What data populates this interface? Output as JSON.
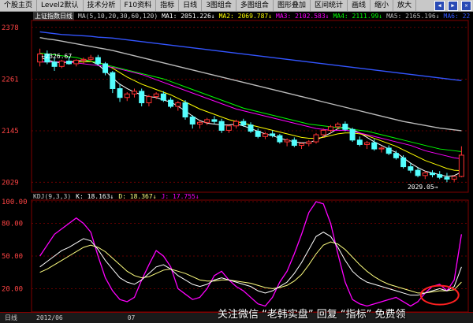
{
  "toolbar": {
    "items": [
      "个股主页",
      "Level2默认",
      "技术分析",
      "F10资料",
      "指标",
      "日线",
      "3图组合",
      "多图组合",
      "图形叠加",
      "区间统计",
      "画线",
      "缩小",
      "放大"
    ],
    "window_buttons": [
      "◀",
      "▶",
      "✕"
    ]
  },
  "main_header": {
    "title": "上证指数日线",
    "ma_params": "MA(5,10,20,30,60,120)",
    "ma1": "MA1: 2051.226↓",
    "ma2": "MA2: 2069.787↓",
    "ma3": "MA3: 2102.583↓",
    "ma4": "MA4: 2111.99↓",
    "ma5": "MA5: 2165.196↓",
    "ma6": "MA6: 22"
  },
  "kdj_header": {
    "name": "KDJ(9,3,3)",
    "k": "K: 18.163↓",
    "d": "D: 18.367↓",
    "j": "J: 17.755↓"
  },
  "price_axis": [
    "2378",
    "2261",
    "2145",
    "2029"
  ],
  "kdj_axis": [
    "100.00",
    "80.00",
    "50.00",
    "20.00"
  ],
  "annotations": {
    "high": "2326.67",
    "low": "2029.05"
  },
  "bottom_bar": {
    "period": "日线",
    "date1": "2012/06",
    "date2": "07"
  },
  "watermark": "关注微信 “老韩实盘” 回复 “指标” 免费领",
  "colors": {
    "up": "#ff3232",
    "down": "#54ffff",
    "ma1": "#ffffff",
    "ma2": "#ffff00",
    "ma3": "#ff00ff",
    "ma4": "#00ff00",
    "ma5": "#bbbbbb",
    "ma6": "#3355ff",
    "k_line": "#ffffff",
    "d_line": "#ffff80",
    "j_line": "#ff00ff",
    "grid": "#800000"
  },
  "chart_data": {
    "type": "candlestick",
    "y_range": [
      2010,
      2390
    ],
    "candles": [
      {
        "o": 2300,
        "h": 2330,
        "l": 2290,
        "c": 2318
      },
      {
        "o": 2318,
        "h": 2326,
        "l": 2295,
        "c": 2300
      },
      {
        "o": 2300,
        "h": 2310,
        "l": 2280,
        "c": 2290
      },
      {
        "o": 2290,
        "h": 2305,
        "l": 2286,
        "c": 2302
      },
      {
        "o": 2302,
        "h": 2312,
        "l": 2294,
        "c": 2296
      },
      {
        "o": 2296,
        "h": 2306,
        "l": 2290,
        "c": 2304
      },
      {
        "o": 2304,
        "h": 2310,
        "l": 2296,
        "c": 2306
      },
      {
        "o": 2306,
        "h": 2316,
        "l": 2300,
        "c": 2310
      },
      {
        "o": 2310,
        "h": 2316,
        "l": 2292,
        "c": 2296
      },
      {
        "o": 2296,
        "h": 2300,
        "l": 2270,
        "c": 2276
      },
      {
        "o": 2276,
        "h": 2280,
        "l": 2230,
        "c": 2240
      },
      {
        "o": 2240,
        "h": 2250,
        "l": 2210,
        "c": 2220
      },
      {
        "o": 2220,
        "h": 2232,
        "l": 2212,
        "c": 2228
      },
      {
        "o": 2228,
        "h": 2240,
        "l": 2220,
        "c": 2234
      },
      {
        "o": 2234,
        "h": 2240,
        "l": 2200,
        "c": 2208
      },
      {
        "o": 2208,
        "h": 2226,
        "l": 2200,
        "c": 2222
      },
      {
        "o": 2222,
        "h": 2232,
        "l": 2216,
        "c": 2228
      },
      {
        "o": 2228,
        "h": 2234,
        "l": 2210,
        "c": 2214
      },
      {
        "o": 2214,
        "h": 2220,
        "l": 2196,
        "c": 2200
      },
      {
        "o": 2200,
        "h": 2212,
        "l": 2190,
        "c": 2208
      },
      {
        "o": 2208,
        "h": 2214,
        "l": 2170,
        "c": 2176
      },
      {
        "o": 2176,
        "h": 2180,
        "l": 2150,
        "c": 2160
      },
      {
        "o": 2160,
        "h": 2168,
        "l": 2150,
        "c": 2164
      },
      {
        "o": 2164,
        "h": 2174,
        "l": 2158,
        "c": 2170
      },
      {
        "o": 2170,
        "h": 2178,
        "l": 2160,
        "c": 2166
      },
      {
        "o": 2166,
        "h": 2172,
        "l": 2140,
        "c": 2146
      },
      {
        "o": 2146,
        "h": 2158,
        "l": 2140,
        "c": 2156
      },
      {
        "o": 2156,
        "h": 2170,
        "l": 2150,
        "c": 2166
      },
      {
        "o": 2166,
        "h": 2172,
        "l": 2154,
        "c": 2158
      },
      {
        "o": 2158,
        "h": 2164,
        "l": 2140,
        "c": 2144
      },
      {
        "o": 2144,
        "h": 2150,
        "l": 2128,
        "c": 2132
      },
      {
        "o": 2132,
        "h": 2142,
        "l": 2126,
        "c": 2138
      },
      {
        "o": 2138,
        "h": 2146,
        "l": 2130,
        "c": 2134
      },
      {
        "o": 2134,
        "h": 2138,
        "l": 2116,
        "c": 2120
      },
      {
        "o": 2120,
        "h": 2128,
        "l": 2110,
        "c": 2124
      },
      {
        "o": 2124,
        "h": 2130,
        "l": 2108,
        "c": 2112
      },
      {
        "o": 2112,
        "h": 2118,
        "l": 2104,
        "c": 2116
      },
      {
        "o": 2116,
        "h": 2124,
        "l": 2110,
        "c": 2120
      },
      {
        "o": 2120,
        "h": 2140,
        "l": 2116,
        "c": 2136
      },
      {
        "o": 2136,
        "h": 2150,
        "l": 2130,
        "c": 2146
      },
      {
        "o": 2146,
        "h": 2158,
        "l": 2140,
        "c": 2154
      },
      {
        "o": 2154,
        "h": 2164,
        "l": 2148,
        "c": 2160
      },
      {
        "o": 2160,
        "h": 2166,
        "l": 2144,
        "c": 2148
      },
      {
        "o": 2148,
        "h": 2152,
        "l": 2120,
        "c": 2124
      },
      {
        "o": 2124,
        "h": 2132,
        "l": 2110,
        "c": 2114
      },
      {
        "o": 2114,
        "h": 2122,
        "l": 2104,
        "c": 2118
      },
      {
        "o": 2118,
        "h": 2126,
        "l": 2100,
        "c": 2104
      },
      {
        "o": 2104,
        "h": 2110,
        "l": 2096,
        "c": 2106
      },
      {
        "o": 2106,
        "h": 2112,
        "l": 2090,
        "c": 2094
      },
      {
        "o": 2094,
        "h": 2100,
        "l": 2080,
        "c": 2084
      },
      {
        "o": 2084,
        "h": 2090,
        "l": 2060,
        "c": 2064
      },
      {
        "o": 2064,
        "h": 2072,
        "l": 2050,
        "c": 2056
      },
      {
        "o": 2056,
        "h": 2062,
        "l": 2040,
        "c": 2044
      },
      {
        "o": 2044,
        "h": 2054,
        "l": 2036,
        "c": 2050
      },
      {
        "o": 2050,
        "h": 2056,
        "l": 2040,
        "c": 2046
      },
      {
        "o": 2046,
        "h": 2054,
        "l": 2036,
        "c": 2040
      },
      {
        "o": 2040,
        "h": 2050,
        "l": 2029,
        "c": 2036
      },
      {
        "o": 2036,
        "h": 2044,
        "l": 2030,
        "c": 2042
      },
      {
        "o": 2042,
        "h": 2110,
        "l": 2040,
        "c": 2090
      }
    ],
    "ma_series": [
      {
        "name": "MA1",
        "values": [
          2310,
          2305,
          2300,
          2298,
          2300,
          2302,
          2304,
          2302,
          2294,
          2280,
          2264,
          2250,
          2240,
          2232,
          2226,
          2222,
          2220,
          2214,
          2210,
          2200,
          2190,
          2178,
          2168,
          2162,
          2160,
          2158,
          2158,
          2160,
          2156,
          2150,
          2144,
          2138,
          2134,
          2128,
          2124,
          2120,
          2118,
          2118,
          2124,
          2132,
          2140,
          2150,
          2154,
          2148,
          2140,
          2130,
          2120,
          2112,
          2104,
          2096,
          2084,
          2072,
          2062,
          2054,
          2050,
          2046,
          2042,
          2044,
          2052
        ]
      },
      {
        "name": "MA2",
        "values": [
          2300,
          2300,
          2300,
          2300,
          2299,
          2300,
          2300,
          2301,
          2299,
          2294,
          2286,
          2276,
          2266,
          2258,
          2250,
          2244,
          2238,
          2232,
          2226,
          2218,
          2210,
          2202,
          2194,
          2188,
          2182,
          2176,
          2170,
          2166,
          2162,
          2158,
          2154,
          2150,
          2146,
          2142,
          2138,
          2134,
          2130,
          2128,
          2128,
          2130,
          2134,
          2138,
          2140,
          2140,
          2138,
          2134,
          2128,
          2122,
          2116,
          2110,
          2102,
          2094,
          2086,
          2078,
          2072,
          2066,
          2060,
          2056,
          2055
        ]
      },
      {
        "name": "MA3",
        "values": [
          2300,
          2300,
          2300,
          2300,
          2300,
          2298,
          2296,
          2294,
          2292,
          2290,
          2288,
          2284,
          2280,
          2276,
          2272,
          2266,
          2260,
          2254,
          2248,
          2242,
          2236,
          2230,
          2224,
          2218,
          2212,
          2206,
          2200,
          2194,
          2190,
          2186,
          2182,
          2178,
          2174,
          2170,
          2166,
          2162,
          2158,
          2154,
          2150,
          2148,
          2146,
          2146,
          2146,
          2144,
          2140,
          2136,
          2132,
          2128,
          2124,
          2120,
          2116,
          2112,
          2106,
          2100,
          2096,
          2092,
          2088,
          2084,
          2082
        ]
      },
      {
        "name": "MA4",
        "values": [
          2320,
          2318,
          2316,
          2314,
          2312,
          2310,
          2306,
          2302,
          2298,
          2294,
          2290,
          2286,
          2282,
          2278,
          2274,
          2270,
          2266,
          2262,
          2256,
          2250,
          2244,
          2238,
          2232,
          2226,
          2220,
          2214,
          2208,
          2202,
          2196,
          2192,
          2188,
          2184,
          2180,
          2176,
          2172,
          2168,
          2164,
          2160,
          2158,
          2156,
          2154,
          2152,
          2150,
          2148,
          2146,
          2144,
          2140,
          2136,
          2132,
          2128,
          2124,
          2120,
          2116,
          2112,
          2108,
          2104,
          2102,
          2100,
          2098
        ]
      },
      {
        "name": "MA5",
        "values": [
          2355,
          2352,
          2350,
          2347,
          2344,
          2341,
          2338,
          2335,
          2332,
          2329,
          2326,
          2322,
          2318,
          2314,
          2310,
          2306,
          2302,
          2298,
          2294,
          2290,
          2286,
          2282,
          2278,
          2274,
          2270,
          2266,
          2262,
          2258,
          2254,
          2250,
          2246,
          2242,
          2238,
          2234,
          2230,
          2226,
          2222,
          2218,
          2214,
          2210,
          2206,
          2202,
          2198,
          2194,
          2190,
          2186,
          2182,
          2178,
          2174,
          2170,
          2166,
          2163,
          2160,
          2157,
          2154,
          2151,
          2149,
          2147,
          2145
        ]
      },
      {
        "name": "MA6",
        "values": [
          2368,
          2366,
          2364,
          2362,
          2361,
          2360,
          2359,
          2358,
          2356,
          2355,
          2354,
          2352,
          2350,
          2348,
          2346,
          2344,
          2342,
          2340,
          2338,
          2336,
          2334,
          2332,
          2330,
          2328,
          2326,
          2324,
          2322,
          2320,
          2318,
          2316,
          2314,
          2312,
          2310,
          2308,
          2306,
          2304,
          2302,
          2300,
          2298,
          2296,
          2294,
          2292,
          2290,
          2288,
          2286,
          2284,
          2282,
          2280,
          2278,
          2276,
          2274,
          2272,
          2270,
          2268,
          2266,
          2264,
          2262,
          2260,
          2258
        ]
      }
    ],
    "kdj": {
      "y_range": [
        0,
        100
      ],
      "K": [
        40,
        45,
        50,
        55,
        58,
        62,
        66,
        64,
        56,
        46,
        38,
        30,
        26,
        24,
        28,
        34,
        40,
        42,
        38,
        32,
        28,
        24,
        22,
        24,
        28,
        30,
        28,
        26,
        24,
        22,
        18,
        16,
        18,
        22,
        26,
        34,
        44,
        56,
        68,
        72,
        68,
        58,
        46,
        36,
        30,
        26,
        24,
        22,
        20,
        18,
        16,
        14,
        14,
        16,
        18,
        20,
        18,
        22,
        40
      ],
      "D": [
        35,
        38,
        42,
        46,
        50,
        54,
        58,
        60,
        58,
        54,
        48,
        42,
        36,
        32,
        30,
        31,
        34,
        37,
        38,
        36,
        34,
        31,
        28,
        27,
        27,
        28,
        28,
        27,
        26,
        25,
        23,
        21,
        20,
        21,
        23,
        27,
        33,
        42,
        52,
        60,
        63,
        61,
        56,
        49,
        42,
        36,
        31,
        27,
        24,
        22,
        20,
        18,
        16,
        16,
        17,
        18,
        18,
        19,
        26
      ],
      "J": [
        50,
        60,
        70,
        75,
        80,
        85,
        80,
        72,
        50,
        30,
        18,
        10,
        8,
        12,
        28,
        42,
        55,
        50,
        40,
        20,
        15,
        10,
        12,
        20,
        32,
        36,
        28,
        22,
        18,
        12,
        6,
        4,
        12,
        26,
        36,
        52,
        70,
        90,
        100,
        98,
        80,
        52,
        26,
        10,
        6,
        4,
        6,
        8,
        10,
        12,
        8,
        4,
        8,
        16,
        22,
        24,
        18,
        28,
        70
      ]
    }
  }
}
